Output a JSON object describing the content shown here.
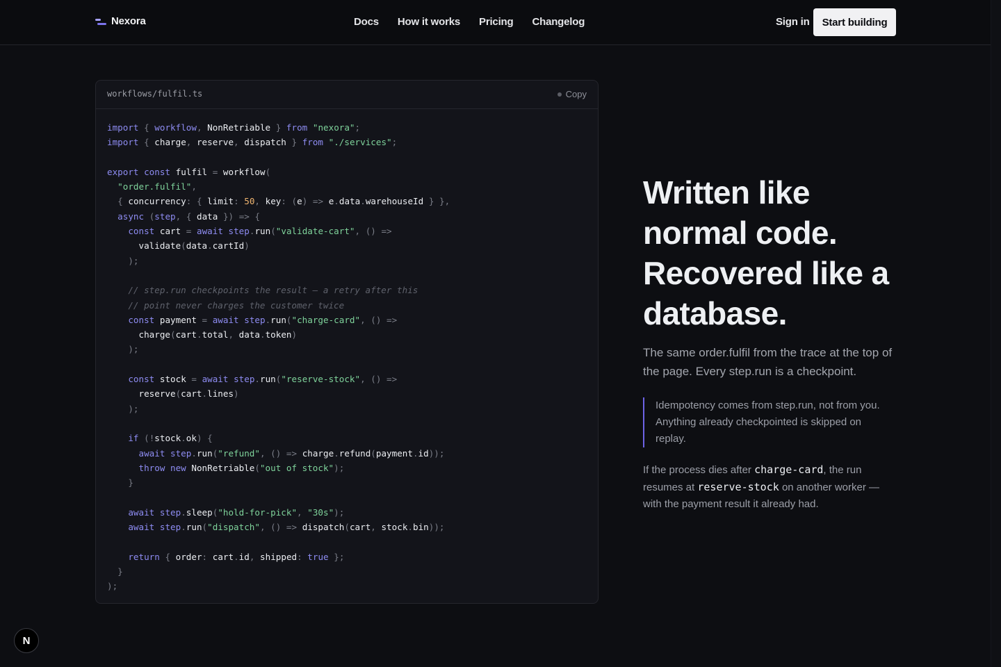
{
  "nav": {
    "brand": "Nexora",
    "links": [
      "Docs",
      "How it works",
      "Pricing",
      "Changelog"
    ],
    "sign_in": "Sign in",
    "cta": "Start building"
  },
  "code_card": {
    "filename": "workflows/fulfil.ts",
    "copy_label": "Copy"
  },
  "section": {
    "headline_lines": [
      "Written like",
      "normal code.",
      "Recovered like a",
      "database."
    ],
    "lead": "The same order.fulfil from the trace at the top of the page. Every step.run is a checkpoint.",
    "quote": "Idempotency comes from step.run, not from you. Anything already checkpointed is skipped on replay.",
    "note_before": "If the process dies after ",
    "note_code1": "charge-card",
    "note_mid": ", the run resumes at ",
    "note_code2": "reserve-stock",
    "note_after": " on another worker — with the payment result it already had."
  },
  "fab_label": "N",
  "colors": {
    "accent": "#6c63e6",
    "keyword": "#8e8cf2",
    "string": "#7fd39b",
    "number": "#f0b570",
    "comment": "#5f626c"
  }
}
